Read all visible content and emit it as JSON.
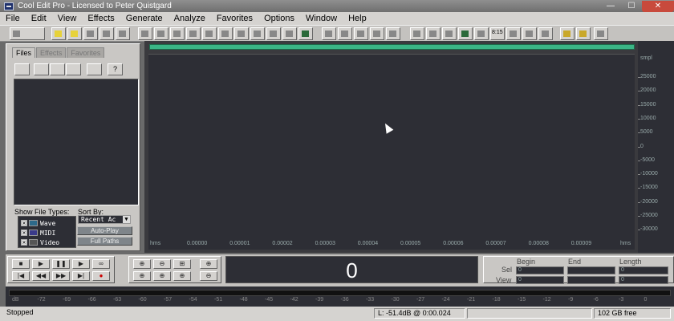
{
  "window": {
    "title": "Cool Edit Pro  - Licensed to Peter Quistgard",
    "min_glyph": "—",
    "max_glyph": "☐",
    "close_glyph": "✕"
  },
  "menu": [
    "File",
    "Edit",
    "View",
    "Effects",
    "Generate",
    "Analyze",
    "Favorites",
    "Options",
    "Window",
    "Help"
  ],
  "toolbar": {
    "buttons": [
      "multitrack-icon",
      "new-icon",
      "open-icon",
      "close-icon",
      "save-icon",
      "save-as-icon",
      "undo-icon",
      "redo-icon",
      "repeat-icon",
      "copy-icon",
      "copy-new-icon",
      "cut-icon",
      "paste-icon",
      "paste-new-icon",
      "mix-paste-icon",
      "trim-icon",
      "mute-icon",
      "spectral-view-icon",
      "waveform-view-icon",
      "grid-icon",
      "grid2-icon",
      "grid3-icon",
      "view1-icon",
      "view2-icon",
      "view3-icon",
      "play-icon",
      "find-icon",
      "tempo-icon",
      "marker-icon",
      "cd-icon",
      "list-icon",
      "effects-icon",
      "cd-player-icon",
      "help-icon"
    ],
    "tempo_label": "8:15"
  },
  "organizer": {
    "tabs": [
      "Files",
      "Effects",
      "Favorites"
    ],
    "active_tab": "Files",
    "tool_icons": [
      "open-folder-icon",
      "close-file-icon",
      "insert-multitrack-icon",
      "edit-file-icon",
      "auto-play-icon",
      "help-icon"
    ],
    "show_file_types_label": "Show File Types:",
    "file_types": [
      {
        "label": "Wave",
        "checked": "✕",
        "icon": "wave-icon"
      },
      {
        "label": "MIDI",
        "checked": "✕",
        "icon": "midi-icon"
      },
      {
        "label": "Video",
        "checked": "✕",
        "icon": "video-icon"
      }
    ],
    "sort_by_label": "Sort By:",
    "sort_value": "Recent Ac",
    "sort_dropdown_glyph": "▼",
    "auto_play_label": "Auto-Play",
    "full_paths_label": "Full Paths"
  },
  "waveform": {
    "overview_color": "#3bb586",
    "background": "#2d2e35",
    "time_labels": [
      "hms",
      "0.00000",
      "0.00001",
      "0.00002",
      "0.00003",
      "0.00004",
      "0.00005",
      "0.00006",
      "0.00007",
      "0.00008",
      "0.00009",
      "hms"
    ],
    "amp_unit": "smpl",
    "amp_labels": [
      "25000",
      "20000",
      "15000",
      "10000",
      "5000",
      "0",
      "-5000",
      "-10000",
      "-15000",
      "-20000",
      "-25000",
      "-30000"
    ]
  },
  "transport": {
    "row1": [
      "■",
      "▶",
      "❚❚",
      "▶",
      "∞"
    ],
    "row2": [
      "|◀",
      "◀◀",
      "▶▶",
      "▶|",
      "●"
    ],
    "zoom_row1": [
      "⊕",
      "⊖",
      "⊞",
      "⊕"
    ],
    "zoom_row2": [
      "⊕",
      "⊕",
      "⊕",
      "⊖"
    ],
    "time_display": "0",
    "selection": {
      "headers": [
        "Begin",
        "End",
        "Length"
      ],
      "rows": [
        {
          "label": "Sel",
          "begin": "0",
          "end": "",
          "length": "0"
        },
        {
          "label": "View",
          "begin": "0",
          "end": "",
          "length": "0"
        }
      ]
    }
  },
  "level_meter": {
    "labels": [
      "dB",
      "-72",
      "-69",
      "-66",
      "-63",
      "-60",
      "-57",
      "-54",
      "-51",
      "-48",
      "-45",
      "-42",
      "-39",
      "-36",
      "-33",
      "-30",
      "-27",
      "-24",
      "-21",
      "-18",
      "-15",
      "-12",
      "-9",
      "-6",
      "-3",
      "0"
    ]
  },
  "status": {
    "state": "Stopped",
    "level": "L: -51.4dB @  0:00.024",
    "free_space": "102 GB free"
  }
}
